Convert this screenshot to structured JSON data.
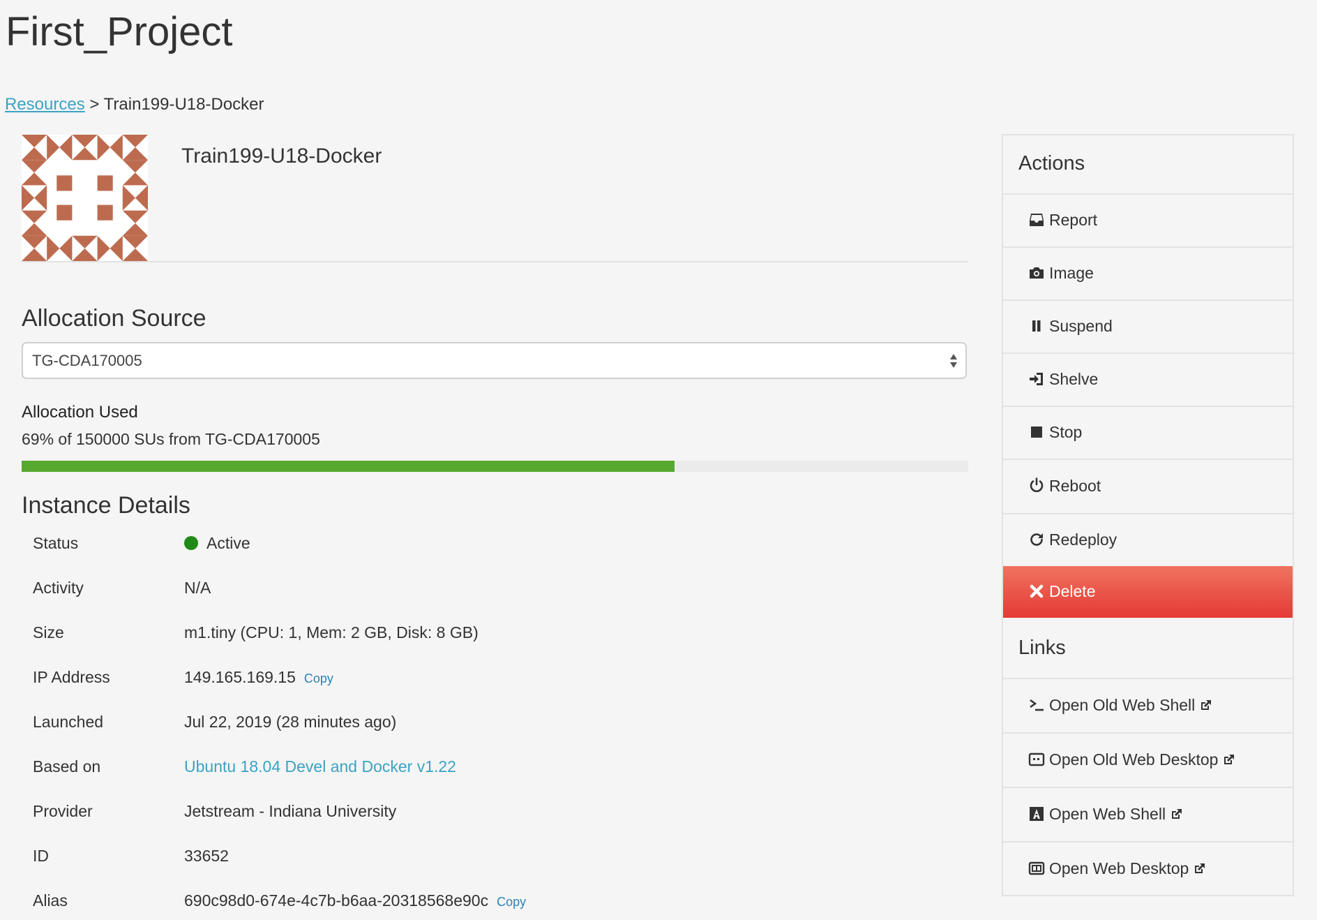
{
  "page": {
    "title": "First_Project"
  },
  "breadcrumb": {
    "link": "Resources",
    "separator": ">",
    "current": "Train199-U18-Docker"
  },
  "instance": {
    "name": "Train199-U18-Docker"
  },
  "allocation": {
    "heading": "Allocation Source",
    "selected": "TG-CDA170005",
    "used_label": "Allocation Used",
    "used_text": "69% of 150000 SUs from TG-CDA170005",
    "used_fraction": 0.69,
    "bar_color": "#56a82f"
  },
  "details": {
    "heading": "Instance Details",
    "copy_label": "Copy",
    "rows": [
      {
        "label": "Status",
        "value": "Active",
        "status_color": "#1f8a16"
      },
      {
        "label": "Activity",
        "value": "N/A"
      },
      {
        "label": "Size",
        "value": "m1.tiny (CPU: 1, Mem: 2 GB, Disk: 8 GB)"
      },
      {
        "label": "IP Address",
        "value": "149.165.169.15"
      },
      {
        "label": "Launched",
        "value": "Jul 22, 2019 (28 minutes ago)"
      },
      {
        "label": "Based on",
        "value": "Ubuntu 18.04 Devel and Docker v1.22"
      },
      {
        "label": "Provider",
        "value": "Jetstream - Indiana University"
      },
      {
        "label": "ID",
        "value": "33652"
      },
      {
        "label": "Alias",
        "value": "690c98d0-674e-4c7b-b6aa-20318568e90c"
      }
    ]
  },
  "actions": {
    "heading": "Actions",
    "items": [
      {
        "label": "Report",
        "icon": "inbox-icon"
      },
      {
        "label": "Image",
        "icon": "camera-icon"
      },
      {
        "label": "Suspend",
        "icon": "pause-icon"
      },
      {
        "label": "Shelve",
        "icon": "log-in-icon"
      },
      {
        "label": "Stop",
        "icon": "stop-icon"
      },
      {
        "label": "Reboot",
        "icon": "power-icon"
      },
      {
        "label": "Redeploy",
        "icon": "refresh-icon"
      },
      {
        "label": "Delete",
        "icon": "close-icon",
        "color": "#e53a35"
      }
    ]
  },
  "links": {
    "heading": "Links",
    "items": [
      {
        "label": "Open Old Web Shell",
        "icon": "terminal-icon"
      },
      {
        "label": "Open Old Web Desktop",
        "icon": "desktop-icon"
      },
      {
        "label": "Open Web Shell",
        "icon": "font-icon"
      },
      {
        "label": "Open Web Desktop",
        "icon": "window-icon"
      }
    ]
  }
}
